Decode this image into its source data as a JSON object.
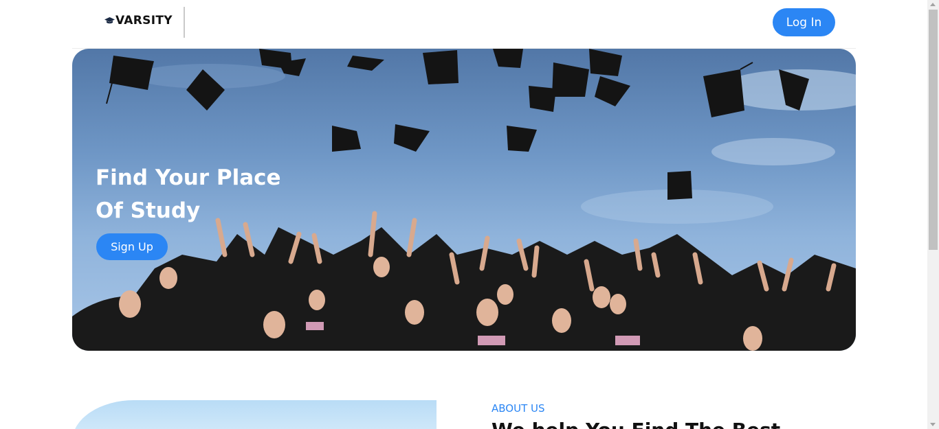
{
  "header": {
    "brand_name": "VARSITY",
    "brand_icon": "graduation-cap-icon",
    "login_label": "Log In"
  },
  "hero": {
    "title_line1": "Find Your Place",
    "title_line2": "Of Study",
    "signup_label": "Sign Up"
  },
  "about": {
    "kicker": "ABOUT US",
    "heading": "We help You Find The Best"
  },
  "colors": {
    "accent": "#2b86f4",
    "text_dark": "#111111",
    "hero_sky": "#6f97c6"
  }
}
